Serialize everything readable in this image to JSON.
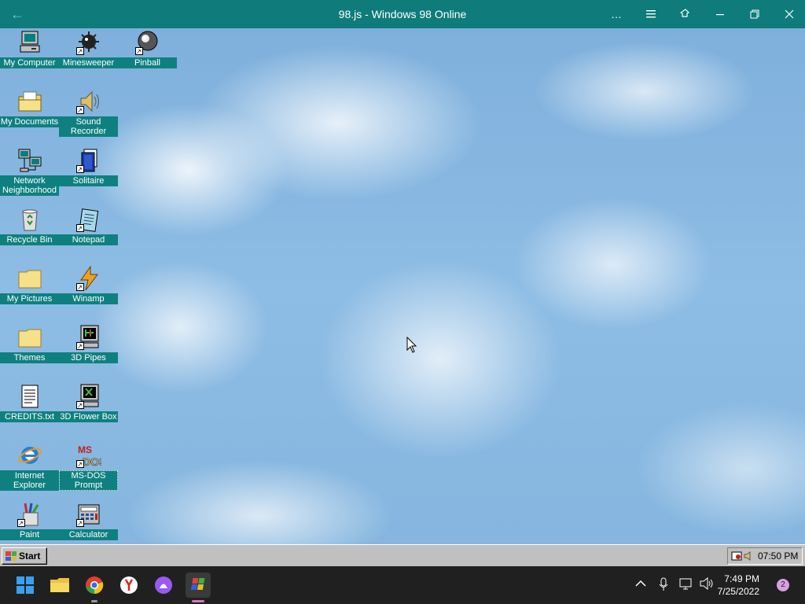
{
  "window": {
    "title": "98.js - Windows 98 Online"
  },
  "desktop_icons": [
    {
      "label": "My Computer",
      "icon": "my-computer-icon"
    },
    {
      "label": "Minesweeper",
      "icon": "minesweeper-icon"
    },
    {
      "label": "Pinball",
      "icon": "pinball-icon"
    },
    {
      "label": "My Documents",
      "icon": "my-documents-icon"
    },
    {
      "label": "Sound Recorder",
      "icon": "sound-recorder-icon"
    },
    {
      "label": "Network Neighborhood",
      "icon": "network-neighborhood-icon"
    },
    {
      "label": "Solitaire",
      "icon": "solitaire-icon"
    },
    {
      "label": "Recycle Bin",
      "icon": "recycle-bin-icon"
    },
    {
      "label": "Notepad",
      "icon": "notepad-icon"
    },
    {
      "label": "My Pictures",
      "icon": "folder-icon"
    },
    {
      "label": "Winamp",
      "icon": "winamp-icon"
    },
    {
      "label": "Themes",
      "icon": "folder-icon"
    },
    {
      "label": "3D Pipes",
      "icon": "3d-pipes-icon"
    },
    {
      "label": "CREDITS.txt",
      "icon": "text-file-icon"
    },
    {
      "label": "3D Flower Box",
      "icon": "3d-flower-box-icon"
    },
    {
      "label": "Internet Explorer",
      "icon": "internet-explorer-icon"
    },
    {
      "label": "MS-DOS Prompt",
      "icon": "ms-dos-icon"
    },
    {
      "label": "Paint",
      "icon": "paint-icon"
    },
    {
      "label": "Calculator",
      "icon": "calculator-icon"
    }
  ],
  "taskbar98": {
    "start_label": "Start",
    "clock": "07:50 PM"
  },
  "host_taskbar": {
    "apps": [
      "windows-start-icon",
      "file-explorer-icon",
      "chrome-icon",
      "yandex-browser-icon",
      "alice-icon",
      "98js-app-icon"
    ],
    "time": "7:49 PM",
    "date": "7/25/2022",
    "notifications": "2"
  },
  "colors": {
    "titlebar": "#0f7b7b",
    "icon_label_bg": "#0f8080",
    "host_taskbar": "#202020"
  }
}
